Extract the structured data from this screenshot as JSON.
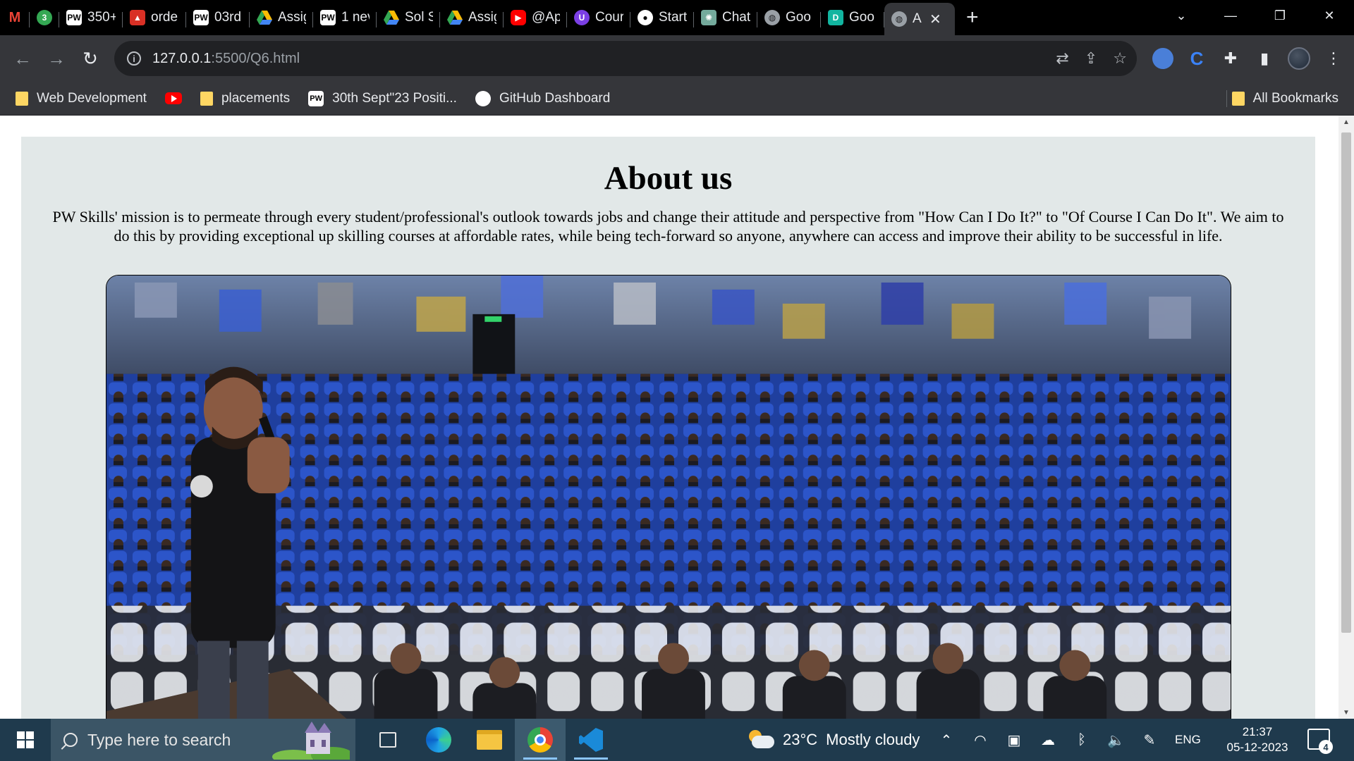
{
  "browser": {
    "tabs": [
      {
        "label": "",
        "icon": "gmail-icon"
      },
      {
        "label": "",
        "icon": "whatsapp-icon"
      },
      {
        "label": "350+",
        "icon": "pw-icon"
      },
      {
        "label": "orde",
        "icon": "pdf-icon"
      },
      {
        "label": "03rd",
        "icon": "pw-icon"
      },
      {
        "label": "Assig",
        "icon": "drive-icon"
      },
      {
        "label": "1 nev",
        "icon": "pw-icon"
      },
      {
        "label": "Sol S",
        "icon": "drive-icon"
      },
      {
        "label": "Assig",
        "icon": "drive-icon"
      },
      {
        "label": "@Ap",
        "icon": "youtube-icon"
      },
      {
        "label": "Cour",
        "icon": "udemy-icon"
      },
      {
        "label": "Start",
        "icon": "github-icon"
      },
      {
        "label": "Chat",
        "icon": "chatgpt-icon"
      },
      {
        "label": "Goo",
        "icon": "globe-icon"
      },
      {
        "label": "Goo",
        "icon": "google-docs-icon"
      },
      {
        "label": "A",
        "icon": "globe-icon",
        "active": true
      }
    ],
    "url_host": "127.0.0.1",
    "url_rest": ":5500/Q6.html",
    "bookmarks": [
      {
        "label": "Web Development",
        "icon": "folder-icon"
      },
      {
        "label": "",
        "icon": "youtube-icon"
      },
      {
        "label": "placements",
        "icon": "folder-icon"
      },
      {
        "label": "30th Sept\"23 Positi...",
        "icon": "pw-icon"
      },
      {
        "label": "GitHub Dashboard",
        "icon": "github-icon"
      }
    ],
    "all_bookmarks": "All Bookmarks"
  },
  "page": {
    "heading": "About us",
    "paragraph": "PW Skills' mission is to permeate through every student/professional's outlook towards jobs and change their attitude and perspective from \"How Can I Do It?\" to \"Of Course I Can Do It\". We aim to do this by providing exceptional up skilling courses at affordable rates, while being tech-forward so anyone, anywhere can access and improve their ability to be successful in life.",
    "image_alt": "Speaker addressing a full auditorium of students",
    "background_color": "#e2e8e8"
  },
  "taskbar": {
    "search_placeholder": "Type here to search",
    "weather_temp": "23°C",
    "weather_desc": "Mostly cloudy",
    "language": "ENG",
    "time": "21:37",
    "date": "05-12-2023",
    "notification_count": "4",
    "accent": "#1f3a4d"
  }
}
